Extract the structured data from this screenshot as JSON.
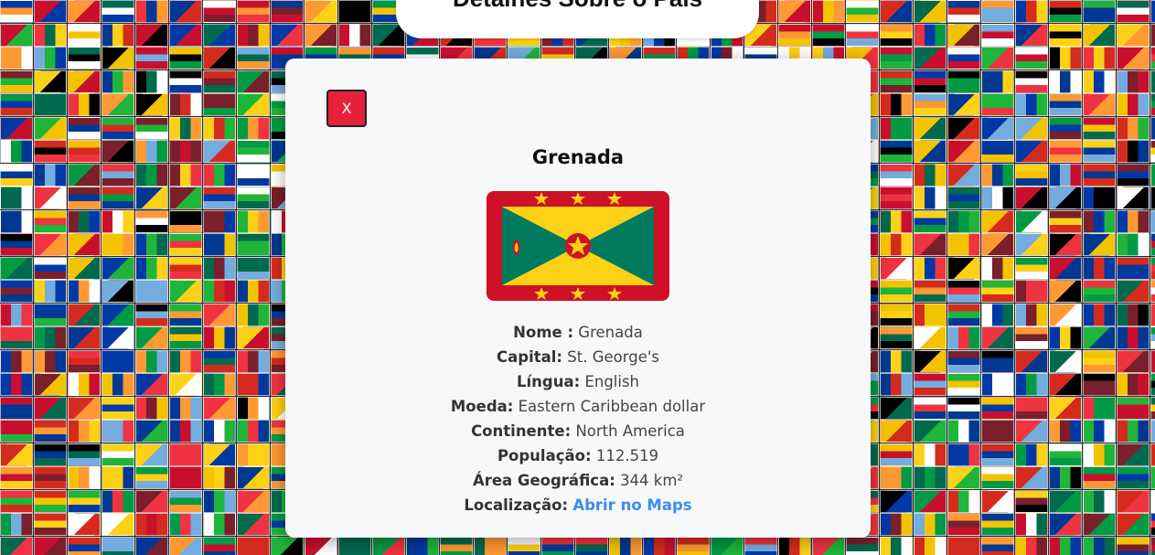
{
  "header": {
    "title": "Detalhes Sobre o País"
  },
  "modal": {
    "close_label": "X",
    "country_name": "Grenada",
    "fields": [
      {
        "label": "Nome :",
        "value": "Grenada"
      },
      {
        "label": "Capital:",
        "value": "St. George's"
      },
      {
        "label": "Língua:",
        "value": "English"
      },
      {
        "label": "Moeda:",
        "value": "Eastern Caribbean dollar"
      },
      {
        "label": "Continente:",
        "value": "North America"
      },
      {
        "label": "População:",
        "value": "112.519"
      },
      {
        "label": "Área Geográfica:",
        "value": "344 km²"
      }
    ],
    "location": {
      "label": "Localização:",
      "link_text": "Abrir no Maps"
    }
  },
  "colors": {
    "close_button": "#e8213a",
    "link": "#3b8ee8",
    "flag_red": "#ce1126",
    "flag_yellow": "#fcd116",
    "flag_green": "#007a5e"
  },
  "background": {
    "palette": [
      "#d52b1e",
      "#ffffff",
      "#003893",
      "#009a44",
      "#fcd116",
      "#000000",
      "#c8102e",
      "#0039a6",
      "#ff9933",
      "#006a4e",
      "#ef3340",
      "#1eb53a",
      "#74acdf",
      "#f4c300",
      "#7a1f2b"
    ]
  }
}
